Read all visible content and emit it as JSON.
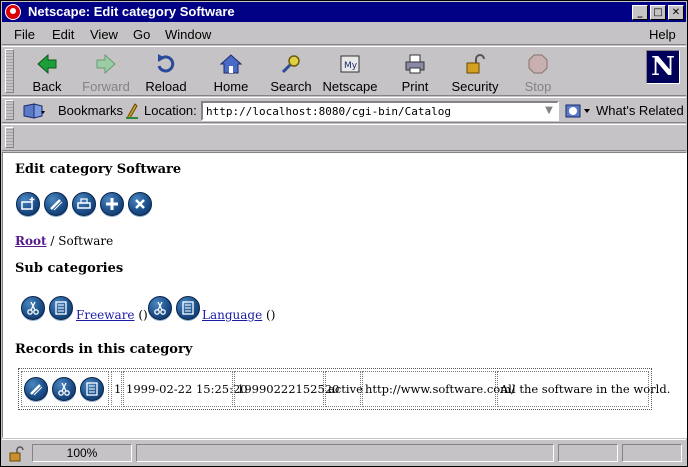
{
  "window": {
    "title": "Netscape: Edit category Software",
    "min": "_",
    "max": "□",
    "close": "✕"
  },
  "menu": [
    "File",
    "Edit",
    "View",
    "Go",
    "Window",
    "Help"
  ],
  "toolbar": {
    "back": "Back",
    "forward": "Forward",
    "reload": "Reload",
    "home": "Home",
    "search": "Search",
    "netscape": "Netscape",
    "print": "Print",
    "security": "Security",
    "stop": "Stop",
    "logo": "N"
  },
  "location": {
    "bookmarks_label": "Bookmarks",
    "location_label": "Location:",
    "url": "http://localhost:8080/cgi-bin/Catalog",
    "whats_related": "What's Related"
  },
  "page": {
    "title": "Edit category Software",
    "breadcrumb": {
      "root": "Root",
      "sep": "/",
      "current": "Software"
    },
    "subcategories_heading": "Sub categories",
    "subcategories": [
      {
        "name": "Freeware",
        "count": "()"
      },
      {
        "name": "Language",
        "count": "()"
      }
    ],
    "records_heading": "Records in this category",
    "records": [
      {
        "id": "1",
        "date": "1999-02-22 15:25:20",
        "key": "19990222152520",
        "status": "active",
        "url": "http://www.software.com/",
        "description": "All the software in the world."
      }
    ]
  },
  "status": {
    "zoom": "100%"
  },
  "colors": {
    "titlebar": "#000084",
    "chrome": "#c6c3c6",
    "button_blue": "#1c4f8a",
    "link": "#1a1aa6",
    "visited": "#551a8b"
  }
}
